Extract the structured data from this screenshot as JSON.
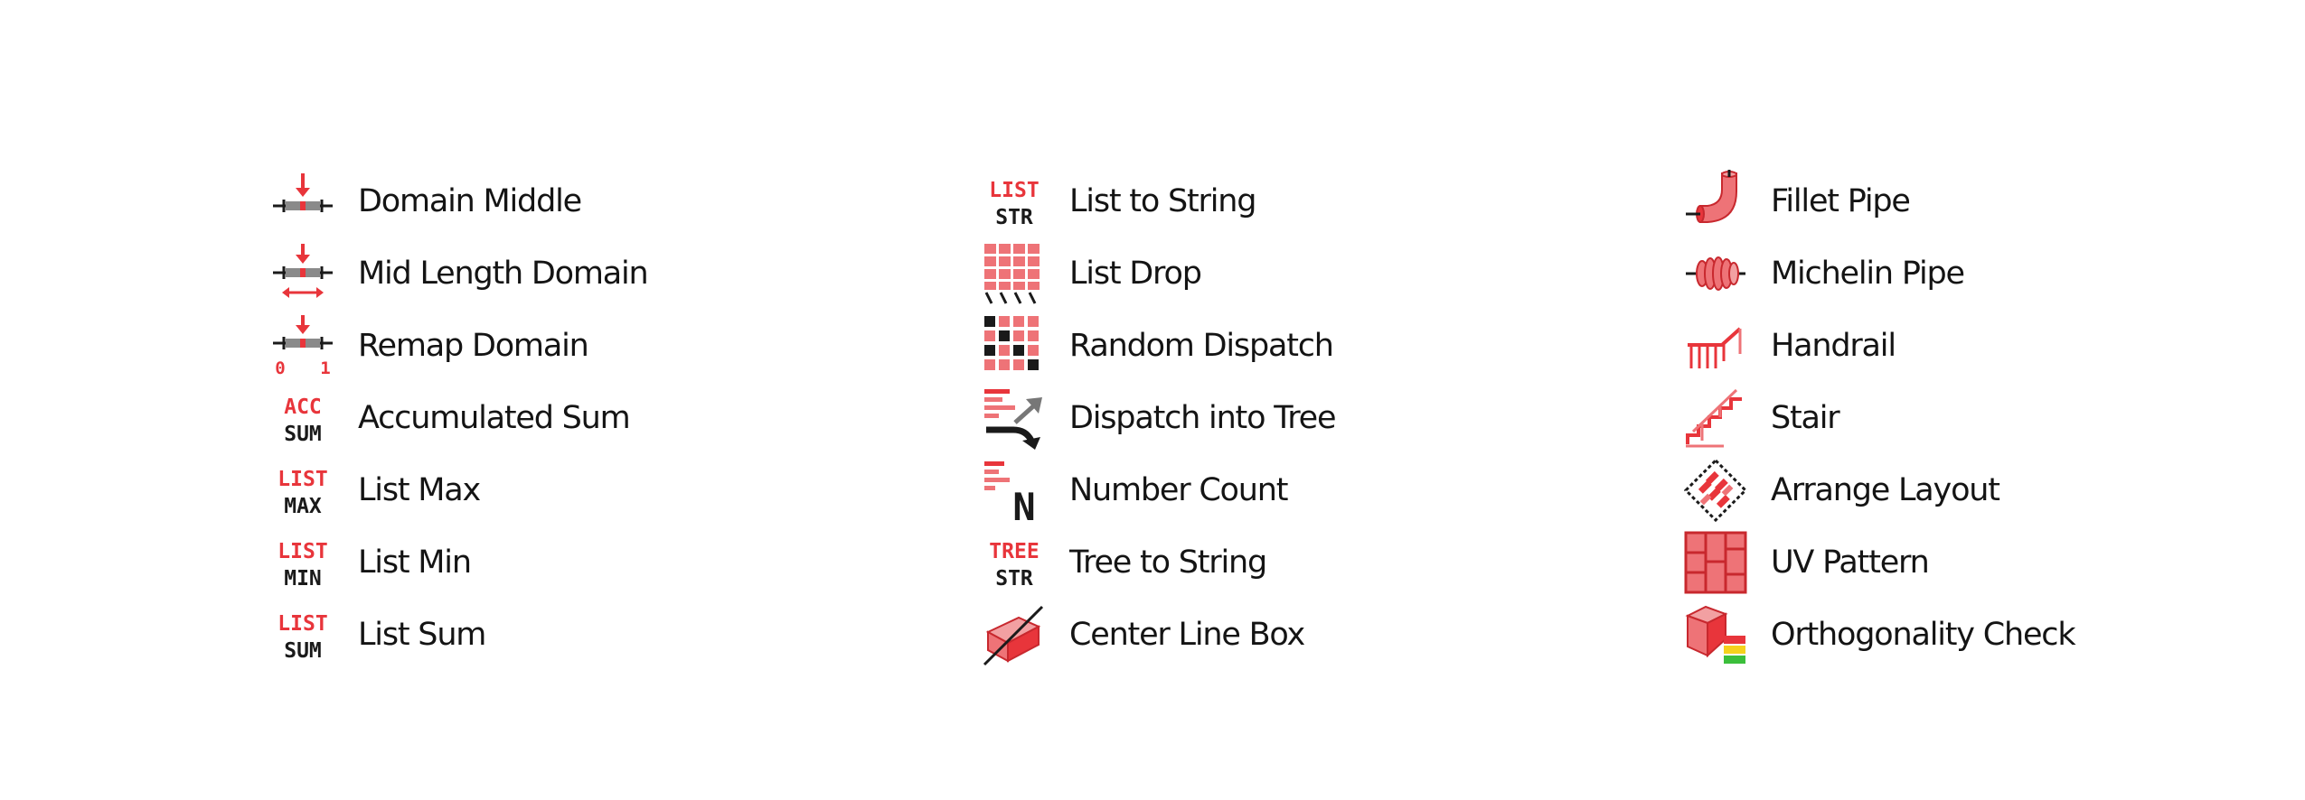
{
  "accent_color": "#e8353b",
  "accent_light_color": "#f2a0a2",
  "dark_color": "#1a1a1a",
  "columns": [
    {
      "items": [
        {
          "label": "Domain Middle",
          "icon": "domain-middle-icon"
        },
        {
          "label": "Mid Length Domain",
          "icon": "mid-length-domain-icon"
        },
        {
          "label": "Remap Domain",
          "icon": "remap-domain-icon",
          "icon_text": [
            "0",
            "1"
          ]
        },
        {
          "label": "Accumulated Sum",
          "icon": "accumulated-sum-icon",
          "icon_text": [
            "ACC",
            "SUM"
          ]
        },
        {
          "label": "List Max",
          "icon": "list-max-icon",
          "icon_text": [
            "LIST",
            "MAX"
          ]
        },
        {
          "label": "List Min",
          "icon": "list-min-icon",
          "icon_text": [
            "LIST",
            "MIN"
          ]
        },
        {
          "label": "List Sum",
          "icon": "list-sum-icon",
          "icon_text": [
            "LIST",
            "SUM"
          ]
        }
      ]
    },
    {
      "items": [
        {
          "label": "List to String",
          "icon": "list-to-string-icon",
          "icon_text": [
            "LIST",
            "STR"
          ]
        },
        {
          "label": "List Drop",
          "icon": "list-drop-icon"
        },
        {
          "label": "Random Dispatch",
          "icon": "random-dispatch-icon"
        },
        {
          "label": "Dispatch into Tree",
          "icon": "dispatch-into-tree-icon"
        },
        {
          "label": "Number Count",
          "icon": "number-count-icon",
          "icon_text": [
            "N"
          ]
        },
        {
          "label": "Tree to String",
          "icon": "tree-to-string-icon",
          "icon_text": [
            "TREE",
            "STR"
          ]
        },
        {
          "label": "Center Line Box",
          "icon": "center-line-box-icon"
        }
      ]
    },
    {
      "items": [
        {
          "label": "Fillet Pipe",
          "icon": "fillet-pipe-icon"
        },
        {
          "label": "Michelin Pipe",
          "icon": "michelin-pipe-icon"
        },
        {
          "label": "Handrail",
          "icon": "handrail-icon"
        },
        {
          "label": "Stair",
          "icon": "stair-icon"
        },
        {
          "label": "Arrange Layout",
          "icon": "arrange-layout-icon"
        },
        {
          "label": "UV Pattern",
          "icon": "uv-pattern-icon"
        },
        {
          "label": "Orthogonality Check",
          "icon": "orthogonality-check-icon"
        }
      ]
    }
  ]
}
